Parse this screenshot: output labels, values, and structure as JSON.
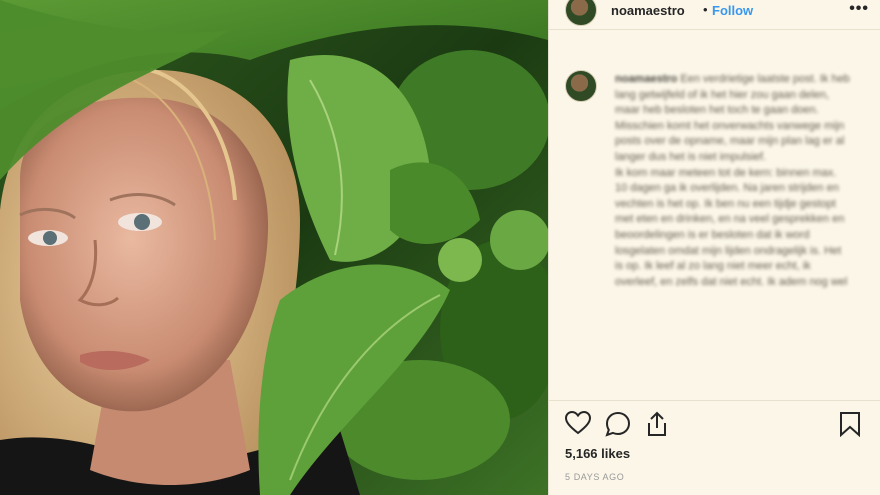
{
  "post": {
    "username": "noamaestro",
    "separator": "•",
    "follow_label": "Follow",
    "more_label": "•••",
    "caption_username": "noamaestro",
    "caption_text": [
      "Een verdrietige laatste post. Ik heb lang getwijfeld of ik het hier zou gaan delen, maar heb besloten het toch te gaan doen.",
      "Misschien komt het onverwachts vanwege mijn posts over de opname, maar mijn plan lag er al langer dus het is niet impulsief.",
      "Ik kom maar meteen tot de kern: binnen max. 10 dagen ga ik overlijden. Na jaren strijden en vechten is het op. Ik ben nu een tijdje gestopt met eten en drinken, en na veel gesprekken en beoordelingen is er besloten dat ik word losgelaten omdat mijn lijden ondragelijk is. Het is op. Ik leef al zo lang niet meer echt, ik overleef, en zelfs dat niet echt. Ik adem nog wel"
    ],
    "likes": "5,166 likes",
    "time_ago": "5 DAYS AGO"
  },
  "icons": {
    "like": "heart-icon",
    "comment": "comment-icon",
    "share": "share-icon",
    "save": "bookmark-icon"
  }
}
